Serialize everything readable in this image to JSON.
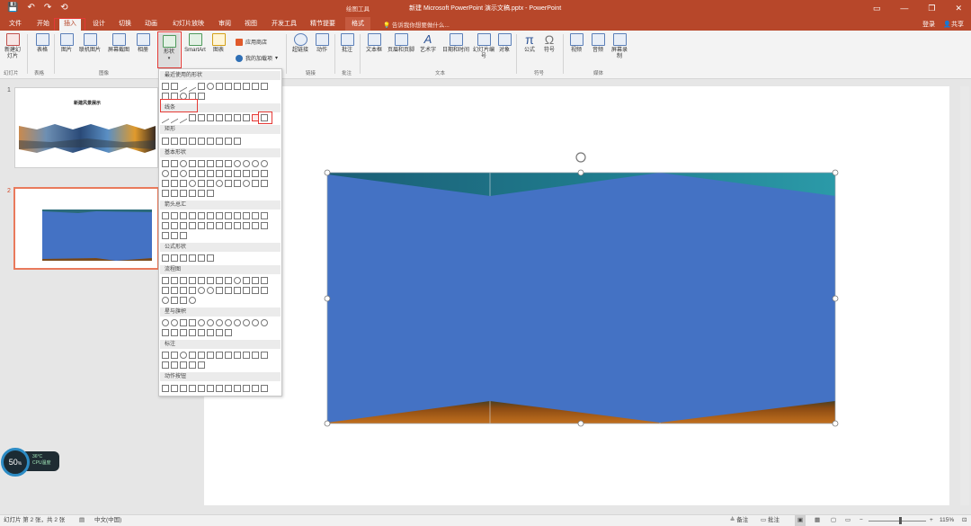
{
  "titlebar": {
    "qat": [
      "💾",
      "↶",
      "↷",
      "⟲"
    ],
    "context_label": "绘图工具",
    "document_title": "新建 Microsoft PowerPoint 演示文稿.pptx - PowerPoint",
    "window_controls": [
      "▭",
      "—",
      "❐",
      "✕"
    ]
  },
  "tabs": {
    "items": [
      "文件",
      "开始",
      "插入",
      "设计",
      "切换",
      "动画",
      "幻灯片放映",
      "审阅",
      "视图",
      "开发工具",
      "精节提要",
      "格式"
    ],
    "active": "插入",
    "context_tab": "格式",
    "tell_me": "告诉我你想要做什么...",
    "login": "登录",
    "share": "共享"
  },
  "ribbon": {
    "buttons": [
      "新建幻灯片",
      "表格",
      "图片",
      "联机图片",
      "屏幕截图",
      "相册",
      "形状",
      "SmartArt",
      "图表",
      "超链接",
      "动作",
      "批注",
      "文本框",
      "页眉和页脚",
      "艺术字",
      "日期和时间",
      "幻灯片编号",
      "对象",
      "公式",
      "符号",
      "视频",
      "音频",
      "屏幕录制"
    ],
    "store": "应用商店",
    "my_addins": "我的加载项",
    "groups": [
      "幻灯片",
      "表格",
      "图像",
      "链接",
      "批注",
      "文本",
      "符号",
      "媒体"
    ]
  },
  "shapes_menu": {
    "sections": [
      "最近使用的形状",
      "线条",
      "矩形",
      "基本形状",
      "箭头总汇",
      "公式形状",
      "流程图",
      "星与旗帜",
      "标注",
      "动作按钮"
    ]
  },
  "slides_pane": {
    "slide1": {
      "number": "1",
      "title": "新建风景展示"
    },
    "slide2": {
      "number": "2"
    }
  },
  "cpu_widget": {
    "percent": "50",
    "unit": "%",
    "temp": "36°C",
    "label": "CPU温度"
  },
  "statusbar": {
    "slide_info": "幻灯片 第 2 张，共 2 张",
    "language": "中文(中国)",
    "notes": "备注",
    "comments": "批注",
    "zoom": "115%"
  },
  "colors": {
    "accent": "#b7472a",
    "shape_fill": "#4472c4",
    "highlight": "#e53935"
  }
}
